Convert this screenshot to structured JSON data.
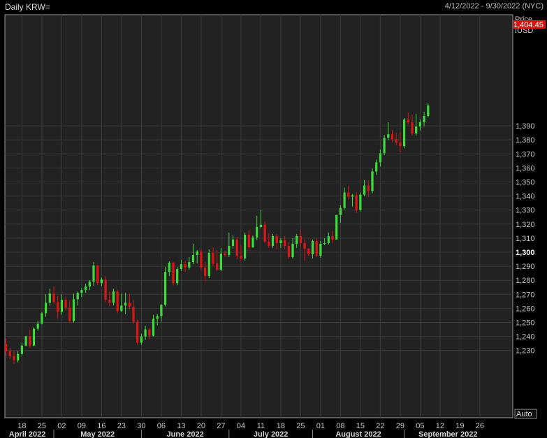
{
  "header": {
    "title": "Daily KRW=",
    "range": "4/12/2022 - 9/30/2022 (NYC)"
  },
  "axis": {
    "price_label": "Price",
    "unit_label": "/USD",
    "auto_button": "Auto"
  },
  "last_price": {
    "label": "1,404.45",
    "value": 1404.45
  },
  "colors": {
    "background": "#222222",
    "grid": "#3a3a3a",
    "up": "#3ddc3d",
    "down": "#e01414",
    "price_tag": "#e01010"
  },
  "chart_data": {
    "type": "candlestick",
    "title": "Daily KRW=",
    "ylabel": "/USD",
    "ylim": [
      1220,
      1405
    ],
    "yticks": [
      {
        "label": "1,230",
        "value": 1230
      },
      {
        "label": "1,240",
        "value": 1240
      },
      {
        "label": "1,250",
        "value": 1250
      },
      {
        "label": "1,260",
        "value": 1260
      },
      {
        "label": "1,270",
        "value": 1270
      },
      {
        "label": "1,280",
        "value": 1280
      },
      {
        "label": "1,290",
        "value": 1290
      },
      {
        "label": "1,300",
        "value": 1300,
        "bold": true
      },
      {
        "label": "1,310",
        "value": 1310
      },
      {
        "label": "1,320",
        "value": 1320
      },
      {
        "label": "1,330",
        "value": 1330
      },
      {
        "label": "1,340",
        "value": 1340
      },
      {
        "label": "1,350",
        "value": 1350
      },
      {
        "label": "1,360",
        "value": 1360
      },
      {
        "label": "1,370",
        "value": 1370
      },
      {
        "label": "1,380",
        "value": 1380
      },
      {
        "label": "1,390",
        "value": 1390
      }
    ],
    "xticks": [
      {
        "label": "18",
        "index": 4
      },
      {
        "label": "25",
        "index": 9
      },
      {
        "label": "02",
        "index": 14
      },
      {
        "label": "09",
        "index": 19
      },
      {
        "label": "16",
        "index": 24
      },
      {
        "label": "23",
        "index": 29
      },
      {
        "label": "30",
        "index": 34
      },
      {
        "label": "06",
        "index": 39
      },
      {
        "label": "13",
        "index": 44
      },
      {
        "label": "20",
        "index": 49
      },
      {
        "label": "27",
        "index": 54
      },
      {
        "label": "04",
        "index": 59
      },
      {
        "label": "11",
        "index": 64
      },
      {
        "label": "18",
        "index": 69
      },
      {
        "label": "25",
        "index": 74
      },
      {
        "label": "01",
        "index": 79
      },
      {
        "label": "08",
        "index": 84
      },
      {
        "label": "15",
        "index": 89
      },
      {
        "label": "22",
        "index": 94
      },
      {
        "label": "29",
        "index": 99
      },
      {
        "label": "05",
        "index": 104
      },
      {
        "label": "12",
        "index": 109
      },
      {
        "label": "19",
        "index": 114
      },
      {
        "label": "26",
        "index": 119
      }
    ],
    "months": [
      {
        "label": "April 2022",
        "start": -1.3,
        "end": 12
      },
      {
        "label": "May 2022",
        "start": 12,
        "end": 34
      },
      {
        "label": "June 2022",
        "start": 34,
        "end": 56
      },
      {
        "label": "July 2022",
        "start": 56,
        "end": 77
      },
      {
        "label": "August 2022",
        "start": 77,
        "end": 100
      },
      {
        "label": "September 2022",
        "start": 100,
        "end": 122
      }
    ],
    "candles": [
      [
        1234.5,
        1238.5,
        1226.5,
        1229.5
      ],
      [
        1229.5,
        1232.0,
        1224.0,
        1226.0
      ],
      [
        1226.0,
        1229.5,
        1220.5,
        1223.0
      ],
      [
        1223.0,
        1229.5,
        1221.5,
        1227.5
      ],
      [
        1227.5,
        1235.5,
        1226.5,
        1233.5
      ],
      [
        1233.5,
        1240.5,
        1233.0,
        1240.0
      ],
      [
        1240.0,
        1245.0,
        1232.0,
        1233.5
      ],
      [
        1233.5,
        1246.5,
        1233.0,
        1245.5
      ],
      [
        1245.5,
        1251.0,
        1244.0,
        1249.0
      ],
      [
        1249.0,
        1257.5,
        1248.5,
        1256.5
      ],
      [
        1256.5,
        1270.0,
        1254.0,
        1264.0
      ],
      [
        1264.0,
        1274.0,
        1262.0,
        1270.5
      ],
      [
        1270.5,
        1275.5,
        1263.0,
        1264.5
      ],
      [
        1264.5,
        1268.5,
        1252.5,
        1257.5
      ],
      [
        1257.5,
        1270.0,
        1255.5,
        1266.0
      ],
      [
        1266.0,
        1268.5,
        1258.5,
        1260.5
      ],
      [
        1260.5,
        1266.0,
        1249.5,
        1251.0
      ],
      [
        1251.0,
        1270.5,
        1250.0,
        1266.5
      ],
      [
        1266.5,
        1272.0,
        1262.0,
        1271.0
      ],
      [
        1271.0,
        1274.5,
        1268.0,
        1273.0
      ],
      [
        1273.0,
        1277.5,
        1271.0,
        1275.5
      ],
      [
        1275.5,
        1280.0,
        1273.0,
        1279.0
      ],
      [
        1279.0,
        1293.0,
        1276.0,
        1290.5
      ],
      [
        1290.5,
        1291.0,
        1276.5,
        1278.0
      ],
      [
        1278.0,
        1282.0,
        1276.0,
        1280.5
      ],
      [
        1280.5,
        1283.0,
        1264.5,
        1266.0
      ],
      [
        1266.0,
        1272.0,
        1261.5,
        1264.0
      ],
      [
        1264.0,
        1274.0,
        1262.0,
        1272.0
      ],
      [
        1272.0,
        1273.0,
        1256.5,
        1258.0
      ],
      [
        1258.0,
        1270.5,
        1257.5,
        1262.0
      ],
      [
        1262.0,
        1271.0,
        1256.0,
        1264.0
      ],
      [
        1264.0,
        1270.0,
        1259.5,
        1261.0
      ],
      [
        1261.0,
        1266.0,
        1249.0,
        1250.5
      ],
      [
        1250.5,
        1252.0,
        1234.0,
        1235.5
      ],
      [
        1235.5,
        1242.0,
        1234.0,
        1240.0
      ],
      [
        1240.0,
        1247.5,
        1237.5,
        1245.0
      ],
      [
        1245.0,
        1246.0,
        1238.0,
        1240.5
      ],
      [
        1240.5,
        1255.5,
        1240.0,
        1252.5
      ],
      [
        1252.5,
        1256.0,
        1248.0,
        1254.5
      ],
      [
        1254.5,
        1263.0,
        1250.5,
        1262.5
      ],
      [
        1262.5,
        1289.5,
        1261.5,
        1286.0
      ],
      [
        1286.0,
        1293.5,
        1283.0,
        1292.5
      ],
      [
        1292.5,
        1293.0,
        1276.5,
        1278.0
      ],
      [
        1278.0,
        1289.5,
        1276.5,
        1288.0
      ],
      [
        1288.0,
        1294.5,
        1286.5,
        1291.5
      ],
      [
        1291.5,
        1294.0,
        1286.0,
        1289.0
      ],
      [
        1289.0,
        1296.5,
        1287.5,
        1293.0
      ],
      [
        1293.0,
        1306.0,
        1291.5,
        1298.0
      ],
      [
        1298.0,
        1301.5,
        1292.0,
        1300.5
      ],
      [
        1300.5,
        1302.0,
        1287.0,
        1289.0
      ],
      [
        1289.0,
        1293.0,
        1279.0,
        1283.0
      ],
      [
        1283.0,
        1302.0,
        1281.5,
        1299.5
      ],
      [
        1299.5,
        1303.5,
        1290.0,
        1292.0
      ],
      [
        1292.0,
        1301.5,
        1286.5,
        1287.5
      ],
      [
        1287.5,
        1303.0,
        1286.5,
        1299.0
      ],
      [
        1299.0,
        1301.0,
        1296.5,
        1298.0
      ],
      [
        1298.0,
        1314.0,
        1296.5,
        1304.5
      ],
      [
        1304.5,
        1312.0,
        1302.5,
        1309.0
      ],
      [
        1309.0,
        1311.0,
        1295.0,
        1297.5
      ],
      [
        1297.5,
        1305.0,
        1293.5,
        1295.5
      ],
      [
        1295.5,
        1314.0,
        1294.0,
        1312.5
      ],
      [
        1312.5,
        1316.0,
        1301.0,
        1303.5
      ],
      [
        1303.5,
        1312.0,
        1303.0,
        1310.5
      ],
      [
        1310.5,
        1326.0,
        1308.5,
        1318.0
      ],
      [
        1318.0,
        1330.0,
        1317.0,
        1319.5
      ],
      [
        1319.5,
        1322.0,
        1306.5,
        1307.5
      ],
      [
        1307.5,
        1313.5,
        1303.0,
        1304.5
      ],
      [
        1304.5,
        1313.0,
        1303.0,
        1311.5
      ],
      [
        1311.5,
        1313.0,
        1302.0,
        1306.5
      ],
      [
        1306.5,
        1310.0,
        1303.0,
        1308.5
      ],
      [
        1308.5,
        1311.5,
        1302.0,
        1304.5
      ],
      [
        1304.5,
        1307.0,
        1295.0,
        1296.5
      ],
      [
        1296.5,
        1310.0,
        1295.5,
        1306.0
      ],
      [
        1306.0,
        1313.0,
        1303.0,
        1311.5
      ],
      [
        1311.5,
        1316.0,
        1304.0,
        1306.5
      ],
      [
        1306.5,
        1309.0,
        1294.0,
        1302.5
      ],
      [
        1302.5,
        1303.0,
        1297.5,
        1298.5
      ],
      [
        1298.5,
        1309.0,
        1295.5,
        1308.0
      ],
      [
        1308.0,
        1310.0,
        1296.5,
        1297.5
      ],
      [
        1297.5,
        1308.0,
        1296.0,
        1306.0
      ],
      [
        1306.0,
        1310.0,
        1305.0,
        1306.5
      ],
      [
        1306.5,
        1314.0,
        1305.5,
        1311.5
      ],
      [
        1311.5,
        1315.0,
        1306.5,
        1309.0
      ],
      [
        1309.0,
        1324.0,
        1309.0,
        1326.5
      ],
      [
        1326.5,
        1333.5,
        1321.0,
        1331.5
      ],
      [
        1331.5,
        1346.0,
        1330.5,
        1342.5
      ],
      [
        1342.5,
        1347.0,
        1337.5,
        1339.5
      ],
      [
        1339.5,
        1341.5,
        1332.5,
        1340.5
      ],
      [
        1340.5,
        1343.0,
        1328.0,
        1330.0
      ],
      [
        1330.0,
        1342.5,
        1329.0,
        1341.0
      ],
      [
        1341.0,
        1351.5,
        1340.0,
        1347.5
      ],
      [
        1347.5,
        1351.0,
        1339.5,
        1343.5
      ],
      [
        1343.5,
        1359.5,
        1342.0,
        1357.5
      ],
      [
        1357.5,
        1366.0,
        1355.0,
        1364.0
      ],
      [
        1364.0,
        1373.0,
        1361.0,
        1370.5
      ],
      [
        1370.5,
        1383.5,
        1369.0,
        1381.5
      ],
      [
        1381.5,
        1392.5,
        1380.0,
        1384.0
      ],
      [
        1384.0,
        1387.0,
        1378.5,
        1380.5
      ],
      [
        1380.5,
        1385.0,
        1376.0,
        1378.0
      ],
      [
        1378.0,
        1385.5,
        1371.0,
        1375.5
      ],
      [
        1375.5,
        1395.5,
        1374.0,
        1394.5
      ],
      [
        1394.5,
        1399.5,
        1391.0,
        1392.5
      ],
      [
        1392.5,
        1398.0,
        1383.0,
        1384.5
      ],
      [
        1384.5,
        1398.5,
        1383.0,
        1389.5
      ],
      [
        1389.5,
        1394.5,
        1386.5,
        1392.5
      ],
      [
        1392.5,
        1400.0,
        1389.5,
        1397.0
      ],
      [
        1397.0,
        1406.0,
        1396.0,
        1404.5
      ]
    ]
  }
}
